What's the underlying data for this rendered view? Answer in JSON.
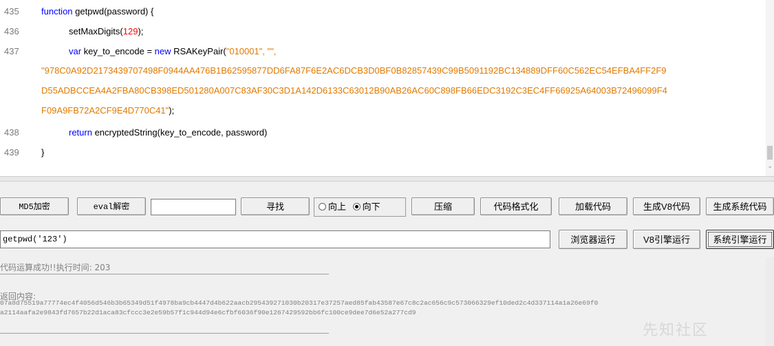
{
  "editor": {
    "lines": [
      {
        "num": "435",
        "indent": 0,
        "tokens": [
          {
            "t": "function ",
            "c": "kw"
          },
          {
            "t": "getpwd(password) {",
            "c": "id"
          }
        ]
      },
      {
        "num": "436",
        "indent": 1,
        "tokens": [
          {
            "t": "setMaxDigits(",
            "c": "id"
          },
          {
            "t": "129",
            "c": "num"
          },
          {
            "t": ");",
            "c": "id"
          }
        ]
      },
      {
        "num": "437",
        "indent": 1,
        "tokens": [
          {
            "t": "var ",
            "c": "kw"
          },
          {
            "t": "key_to_encode = ",
            "c": "id"
          },
          {
            "t": "new ",
            "c": "kw"
          },
          {
            "t": "RSAKeyPair(",
            "c": "id"
          },
          {
            "t": "\"010001\", \"\",",
            "c": "str"
          }
        ]
      },
      {
        "num": "",
        "indent": 0,
        "tokens": [
          {
            "t": "\"978C0A92D2173439707498F0944AA476B1B62595877DD6FA87F6E2AC6DCB3D0BF0B82857439C99B5091192BC134889DFF60C562EC54EFBA4FF2F9",
            "c": "str"
          }
        ]
      },
      {
        "num": "",
        "indent": 0,
        "tokens": [
          {
            "t": "D55ADBCCEA4A2FBA80CB398ED501280A007C83AF30C3D1A142D6133C63012B90AB26AC60C898FB66EDC3192C3EC4FF66925A64003B72496099F4",
            "c": "str"
          }
        ]
      },
      {
        "num": "",
        "indent": 0,
        "tokens": [
          {
            "t": "F09A9FB72A2CF9E4D770C41\"",
            "c": "str"
          },
          {
            "t": ");",
            "c": "id"
          }
        ]
      },
      {
        "num": "438",
        "indent": 1,
        "tokens": [
          {
            "t": "return ",
            "c": "kw"
          },
          {
            "t": "encryptedString(key_to_encode, password)",
            "c": "id"
          }
        ]
      },
      {
        "num": "439",
        "indent": 0,
        "tokens": [
          {
            "t": "}",
            "c": "id"
          }
        ]
      }
    ]
  },
  "toolbar": {
    "md5_label": "MD5加密",
    "eval_label": "eval解密",
    "find_input_value": "",
    "find_label": "寻找",
    "radio_up_label": "向上",
    "radio_down_label": "向下",
    "compress_label": "压缩",
    "format_label": "代码格式化",
    "load_label": "加载代码",
    "gen_v8_label": "生成V8代码",
    "gen_system_label": "生成系统代码"
  },
  "run_bar": {
    "command_value": "getpwd('123')",
    "browser_run_label": "浏览器运行",
    "v8_run_label": "V8引擎运行",
    "system_run_label": "系统引擎运行"
  },
  "output": {
    "status_text": "代码运算成功!!执行时间: 203",
    "return_label": "返回内容:",
    "result_line1": "07a8d75519a77774ec4f4056d546b3b65349d51f4978ba9cb4447d4b622aacb295439271030b20317e37257aed85fab43587e67c8c2ac656c9c573066329ef10ded2c4d337114a1a26e69f0",
    "result_line2": "a2114aafa2e9843fd7657b22d1aca83cfccc3e2e59b57f1c944d94e6cfbf6036f90e1267429592bb6fc100ce9dee7d6e52a277cd9",
    "watermark": "先知社区"
  }
}
